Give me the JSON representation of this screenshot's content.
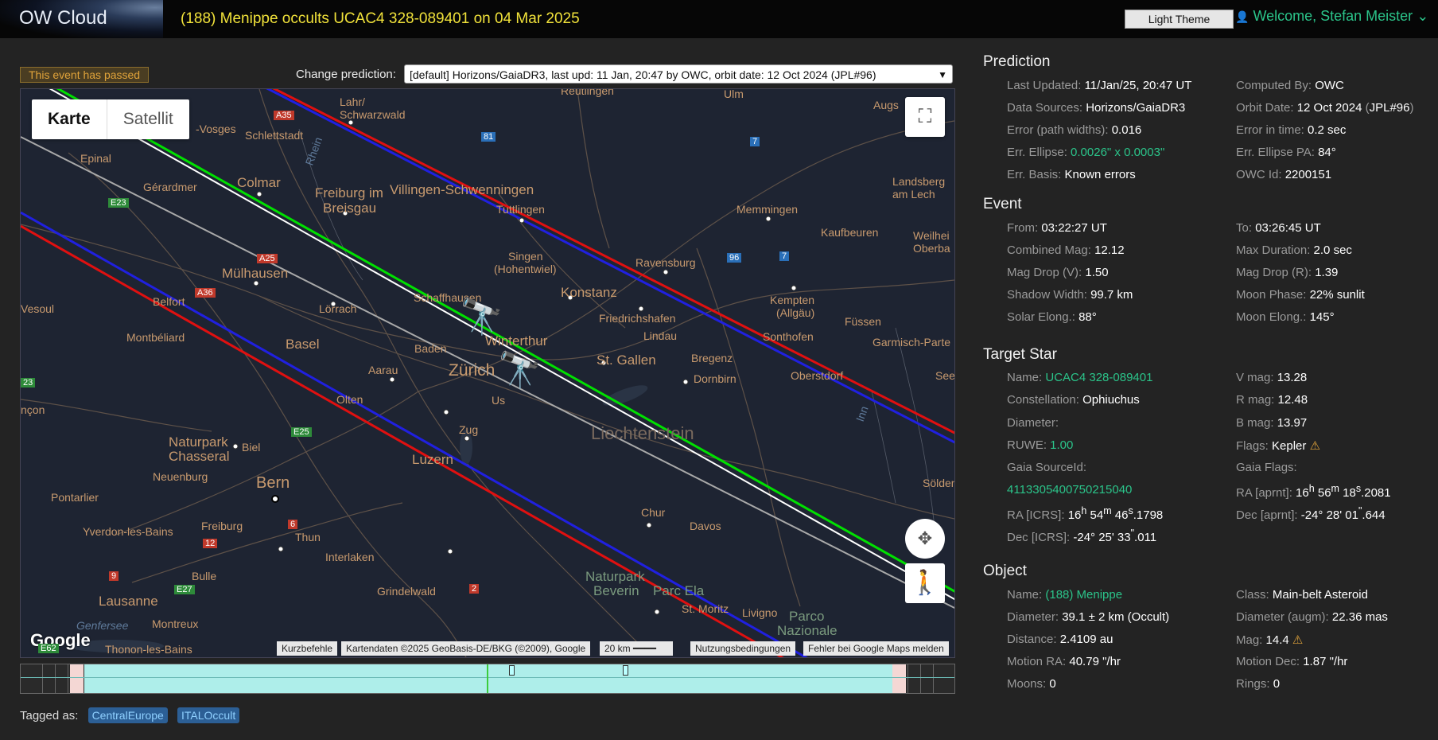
{
  "header": {
    "logo": "OW Cloud",
    "title": "(188) Menippe occults UCAC4 328-089401 on 04 Mar 2025",
    "theme_button": "Light Theme",
    "welcome": "Welcome, Stefan Meister"
  },
  "status": {
    "passed": "This event has passed"
  },
  "prediction_select": {
    "label": "Change prediction:",
    "value": "[default] Horizons/GaiaDR3, last upd: 11 Jan, 20:47 by OWC, orbit date: 12 Oct 2024 (JPL#96)"
  },
  "map": {
    "type_map": "Karte",
    "type_satellite": "Satellit",
    "logo": "Google",
    "attribution": {
      "shortcuts": "Kurzbefehle",
      "data": "Kartendaten ©2025 GeoBasis-DE/BKG (©2009), Google",
      "scale": "20 km",
      "terms": "Nutzungsbedingungen",
      "report": "Fehler bei Google Maps melden"
    },
    "labels": {
      "reutlingen": "Reutlingen",
      "ulm": "Ulm",
      "augsburg": "Augs",
      "lahr": "Lahr/",
      "schwarzwald": "Schwarzwald",
      "vosges": "-Vosges",
      "schlettstadt": "Schlettstadt",
      "epinal": "Epinal",
      "gerardmer": "Gérardmer",
      "colmar": "Colmar",
      "freiburg": "Freiburg im",
      "breisgau": "Breisgau",
      "villingen": "Villingen-Schwenningen",
      "tuttlingen": "Tuttlingen",
      "memmingen": "Memmingen",
      "landsberg": "Landsberg",
      "amlech": "am Lech",
      "kaufbeuren": "Kaufbeuren",
      "weilheim": "Weilhei",
      "oberbay": "Oberba",
      "singen": "Singen",
      "hohentwiel": "(Hohentwiel)",
      "ravensburg": "Ravensburg",
      "muelhausen": "Mülhausen",
      "loerrach": "Lörrach",
      "schaffhausen": "Schaffhausen",
      "konstanz": "Konstanz",
      "friedrichshafen": "Friedrichshafen",
      "kempten": "Kempten",
      "allgaeu": "(Allgäu)",
      "vesoul": "Vesoul",
      "belfort": "Belfort",
      "montbeliard": "Montbéliard",
      "basel": "Basel",
      "winterthur": "Winterthur",
      "lindau": "Lindau",
      "fuessen": "Füssen",
      "garmisch": "Garmisch-Parte",
      "sonthofen": "Sonthofen",
      "baden": "Baden",
      "stgallen": "St. Gallen",
      "bregenz": "Bregenz",
      "dornbirn": "Dornbirn",
      "oberstdorf": "Oberstdorf",
      "aarau": "Aarau",
      "zuerich": "Zürich",
      "uster": "Us",
      "olten": "Olten",
      "see": "See",
      "ncon": "nçon",
      "zug": "Zug",
      "liechtenstein": "Liechtenstein",
      "naturpark_ch": "Naturpark",
      "chasseral": "Chasseral",
      "biel": "Biel",
      "luzern": "Luzern",
      "neuenburg": "Neuenburg",
      "bern": "Bern",
      "soelden": "Sölden",
      "pontarlier": "Pontarlier",
      "chur": "Chur",
      "davos": "Davos",
      "yverdon": "Yverdon-les-Bains",
      "thun": "Thun",
      "freiburg_ch": "Freiburg",
      "interlaken": "Interlaken",
      "bulle": "Bulle",
      "naturpark_bev": "Naturpark",
      "beverin": "Beverin",
      "parcela": "Parc Ela",
      "lausanne": "Lausanne",
      "grindelwald": "Grindelwald",
      "stmoritz": "St. Moritz",
      "livigno": "Livigno",
      "parco": "Parco",
      "nazionale": "Nazionale",
      "montreux": "Montreux",
      "thonon": "Thonon-les-Bains",
      "genfersee": "Genfersee",
      "rhein": "Rhein",
      "inn": "Inn"
    },
    "shields": {
      "a35": "A35",
      "r81": "81",
      "r7a": "7",
      "e23": "E23",
      "a25": "A25",
      "a36": "A36",
      "r96": "96",
      "r7b": "7",
      "e23b": "23",
      "e25": "E25",
      "r6": "6",
      "r12": "12",
      "r9": "9",
      "e27": "E27",
      "r2": "2",
      "e62": "E62"
    }
  },
  "tags": {
    "label": "Tagged as:",
    "items": [
      "CentralEurope",
      "ITALOccult"
    ]
  },
  "prediction": {
    "heading": "Prediction",
    "last_updated_label": "Last Updated:",
    "last_updated": "11/Jan/25, 20:47 UT",
    "computed_by_label": "Computed By:",
    "computed_by": "OWC",
    "data_sources_label": "Data Sources:",
    "data_sources": "Horizons/GaiaDR3",
    "orbit_date_label": "Orbit Date:",
    "orbit_date": "12 Oct 2024",
    "orbit_paren_open": "(",
    "orbit_jpl": "JPL#96",
    "orbit_paren_close": ")",
    "error_pw_label": "Error (path widths):",
    "error_pw": "0.016",
    "error_time_label": "Error in time:",
    "error_time": "0.2 sec",
    "err_ellipse_label": "Err. Ellipse:",
    "err_ellipse": "0.0026\" x 0.0003\"",
    "err_pa_label": "Err. Ellipse PA:",
    "err_pa": "84°",
    "err_basis_label": "Err. Basis:",
    "err_basis": "Known errors",
    "owc_id_label": "OWC Id:",
    "owc_id": "2200151"
  },
  "event": {
    "heading": "Event",
    "from_label": "From:",
    "from": "03:22:27 UT",
    "to_label": "To:",
    "to": "03:26:45 UT",
    "comb_mag_label": "Combined Mag:",
    "comb_mag": "12.12",
    "max_dur_label": "Max Duration:",
    "max_dur": "2.0 sec",
    "magdrop_v_label": "Mag Drop (V):",
    "magdrop_v": "1.50",
    "magdrop_r_label": "Mag Drop (R):",
    "magdrop_r": "1.39",
    "shadow_label": "Shadow Width:",
    "shadow": "99.7 km",
    "moon_phase_label": "Moon Phase:",
    "moon_phase": "22% sunlit",
    "solar_elong_label": "Solar Elong.:",
    "solar_elong": "88°",
    "moon_elong_label": "Moon Elong.:",
    "moon_elong": "145°"
  },
  "target_star": {
    "heading": "Target Star",
    "name_label": "Name:",
    "name": "UCAC4 328-089401",
    "vmag_label": "V mag:",
    "vmag": "13.28",
    "const_label": "Constellation:",
    "const": "Ophiuchus",
    "rmag_label": "R mag:",
    "rmag": "12.48",
    "diam_label": "Diameter:",
    "bmag_label": "B mag:",
    "bmag": "13.97",
    "ruwe_label": "RUWE:",
    "ruwe": "1.00",
    "flags_label": "Flags:",
    "flags": "Kepler",
    "gaia_src_label": "Gaia SourceId:",
    "gaia_src": "4113305400750215040",
    "gaia_flags_label": "Gaia Flags:",
    "ra_icrs_label": "RA [ICRS]:",
    "ra_icrs_h": "16",
    "ra_icrs_m": "54",
    "ra_icrs_s": "46",
    "ra_icrs_frac": ".1798",
    "ra_aprnt_label": "RA [aprnt]:",
    "ra_aprnt_h": "16",
    "ra_aprnt_m": "56",
    "ra_aprnt_s": "18",
    "ra_aprnt_frac": ".2081",
    "dec_icrs_label": "Dec [ICRS]:",
    "dec_icrs_dm": "-24° 25' 33",
    "dec_icrs_frac": ".011",
    "dec_aprnt_label": "Dec [aprnt]:",
    "dec_aprnt_dm": "-24° 28' 01",
    "dec_aprnt_frac": ".644"
  },
  "object": {
    "heading": "Object",
    "name_label": "Name:",
    "name": "(188) Menippe",
    "class_label": "Class:",
    "class": "Main-belt Asteroid",
    "diam_label": "Diameter:",
    "diam": "39.1 ± 2 km",
    "diam_src": "(Occult)",
    "diam_augm_label": "Diameter (augm):",
    "diam_augm": "22.36 mas",
    "dist_label": "Distance:",
    "dist": "2.4109 au",
    "mag_label": "Mag:",
    "mag": "14.4",
    "motion_ra_label": "Motion RA:",
    "motion_ra": "40.79 \"/hr",
    "motion_dec_label": "Motion Dec:",
    "motion_dec": "1.87 \"/hr",
    "moons_label": "Moons:",
    "moons": "0",
    "rings_label": "Rings:",
    "rings": "0"
  },
  "colors": {
    "accent": "#2bc48a",
    "title": "#f1e23a",
    "path_center": "#ffffff",
    "path_green": "#00e000",
    "path_blue": "#2020e0",
    "path_red": "#e01010"
  }
}
